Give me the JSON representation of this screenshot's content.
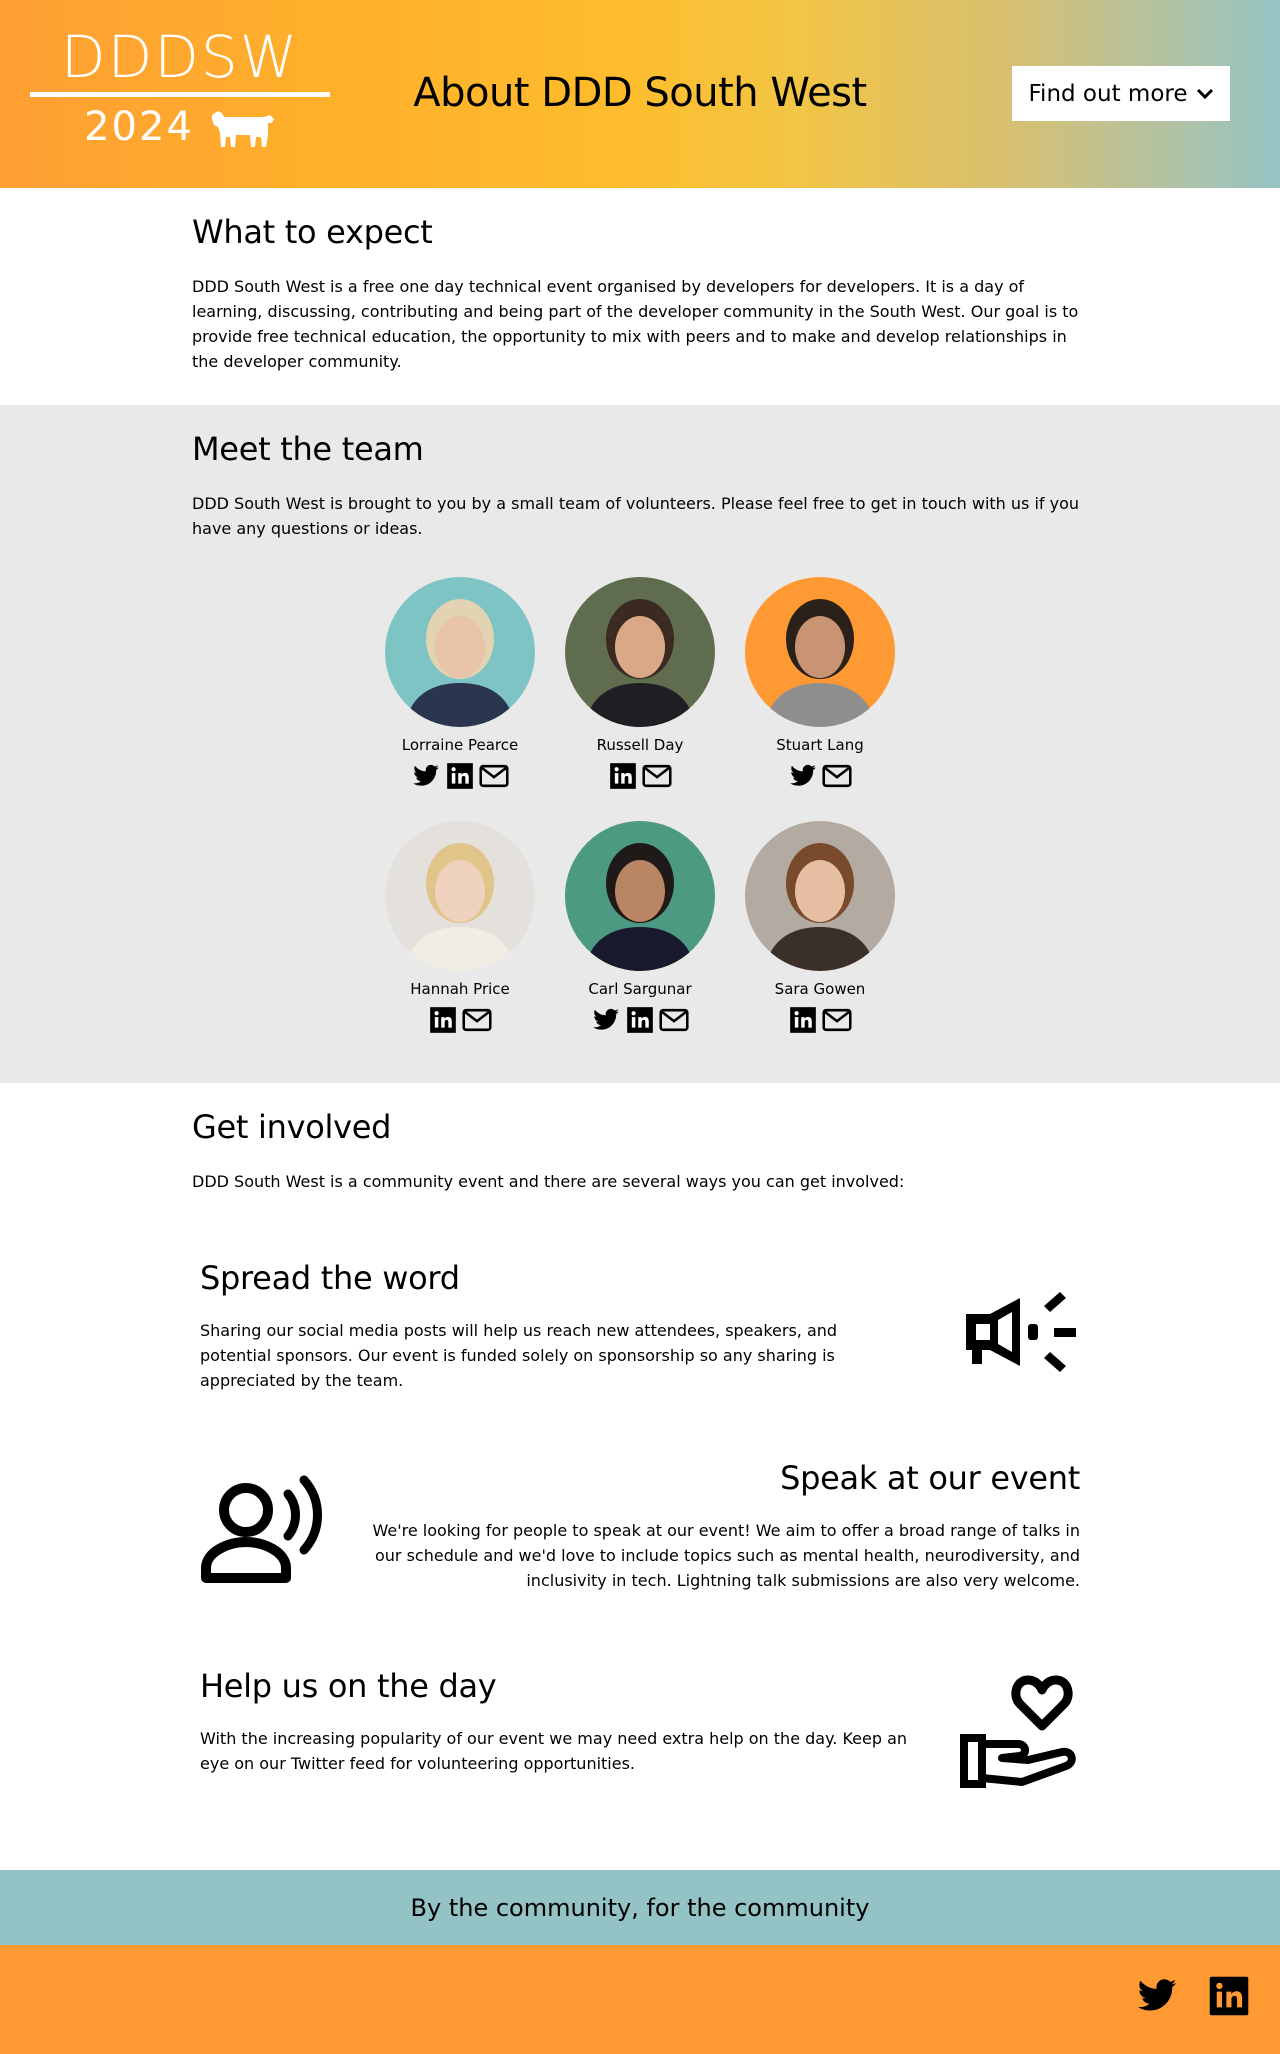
{
  "header": {
    "logo_top": "DDDSW",
    "logo_year": "2024",
    "title": "About DDD South West",
    "find_out_more": "Find out more"
  },
  "expect": {
    "title": "What to expect",
    "text": "DDD South West is a free one day technical event organised by developers for developers. It is a day of learning, discussing, contributing and being part of the developer community in the South West. Our goal is to provide free technical education, the opportunity to mix with peers and to make and develop relationships in the developer community."
  },
  "team": {
    "title": "Meet the team",
    "text": "DDD South West is brought to you by a small team of volunteers. Please feel free to get in touch with us if you have any questions or ideas.",
    "members": [
      {
        "name": "Lorraine Pearce",
        "bg": "#7ec4c4",
        "socials": [
          "twitter-icon",
          "linkedin-icon",
          "email-icon"
        ]
      },
      {
        "name": "Russell Day",
        "bg": "#5f6d4e",
        "socials": [
          "linkedin-icon",
          "email-icon"
        ]
      },
      {
        "name": "Stuart Lang",
        "bg": "#ff9933",
        "socials": [
          "twitter-icon",
          "email-icon"
        ]
      },
      {
        "name": "Hannah Price",
        "bg": "#e4e0db",
        "socials": [
          "linkedin-icon",
          "email-icon"
        ]
      },
      {
        "name": "Carl Sargunar",
        "bg": "#4c9a82",
        "socials": [
          "twitter-icon",
          "linkedin-icon",
          "email-icon"
        ]
      },
      {
        "name": "Sara Gowen",
        "bg": "#b3aaa2",
        "socials": [
          "linkedin-icon",
          "email-icon"
        ]
      }
    ]
  },
  "involved": {
    "title": "Get involved",
    "intro": "DDD South West is a community event and there are several ways you can get involved:",
    "blocks": [
      {
        "title": "Spread the word",
        "icon": "megaphone-icon",
        "text": "Sharing our social media posts will help us reach new attendees, speakers, and potential sponsors. Our event is funded solely on sponsorship so any sharing is appreciated by the team."
      },
      {
        "title": "Speak at our event",
        "icon": "speaker-icon",
        "text": "We're looking for people to speak at our event! We aim to offer a broad range of talks in our schedule and we'd love to include topics such as mental health, neurodiversity, and inclusivity in tech. Lightning talk submissions are also very welcome."
      },
      {
        "title": "Help us on the day",
        "icon": "hand-heart-icon",
        "text": "With the increasing popularity of our event we may need extra help on the day. Keep an eye on our Twitter feed for volunteering opportunities."
      }
    ]
  },
  "footer": {
    "tagline": "By the community, for the community",
    "icons": [
      "twitter-icon",
      "linkedin-icon"
    ]
  },
  "colors": {
    "orange": "#ff9933",
    "teal": "#94c3c6",
    "grey_band": "#e9e9e9"
  }
}
